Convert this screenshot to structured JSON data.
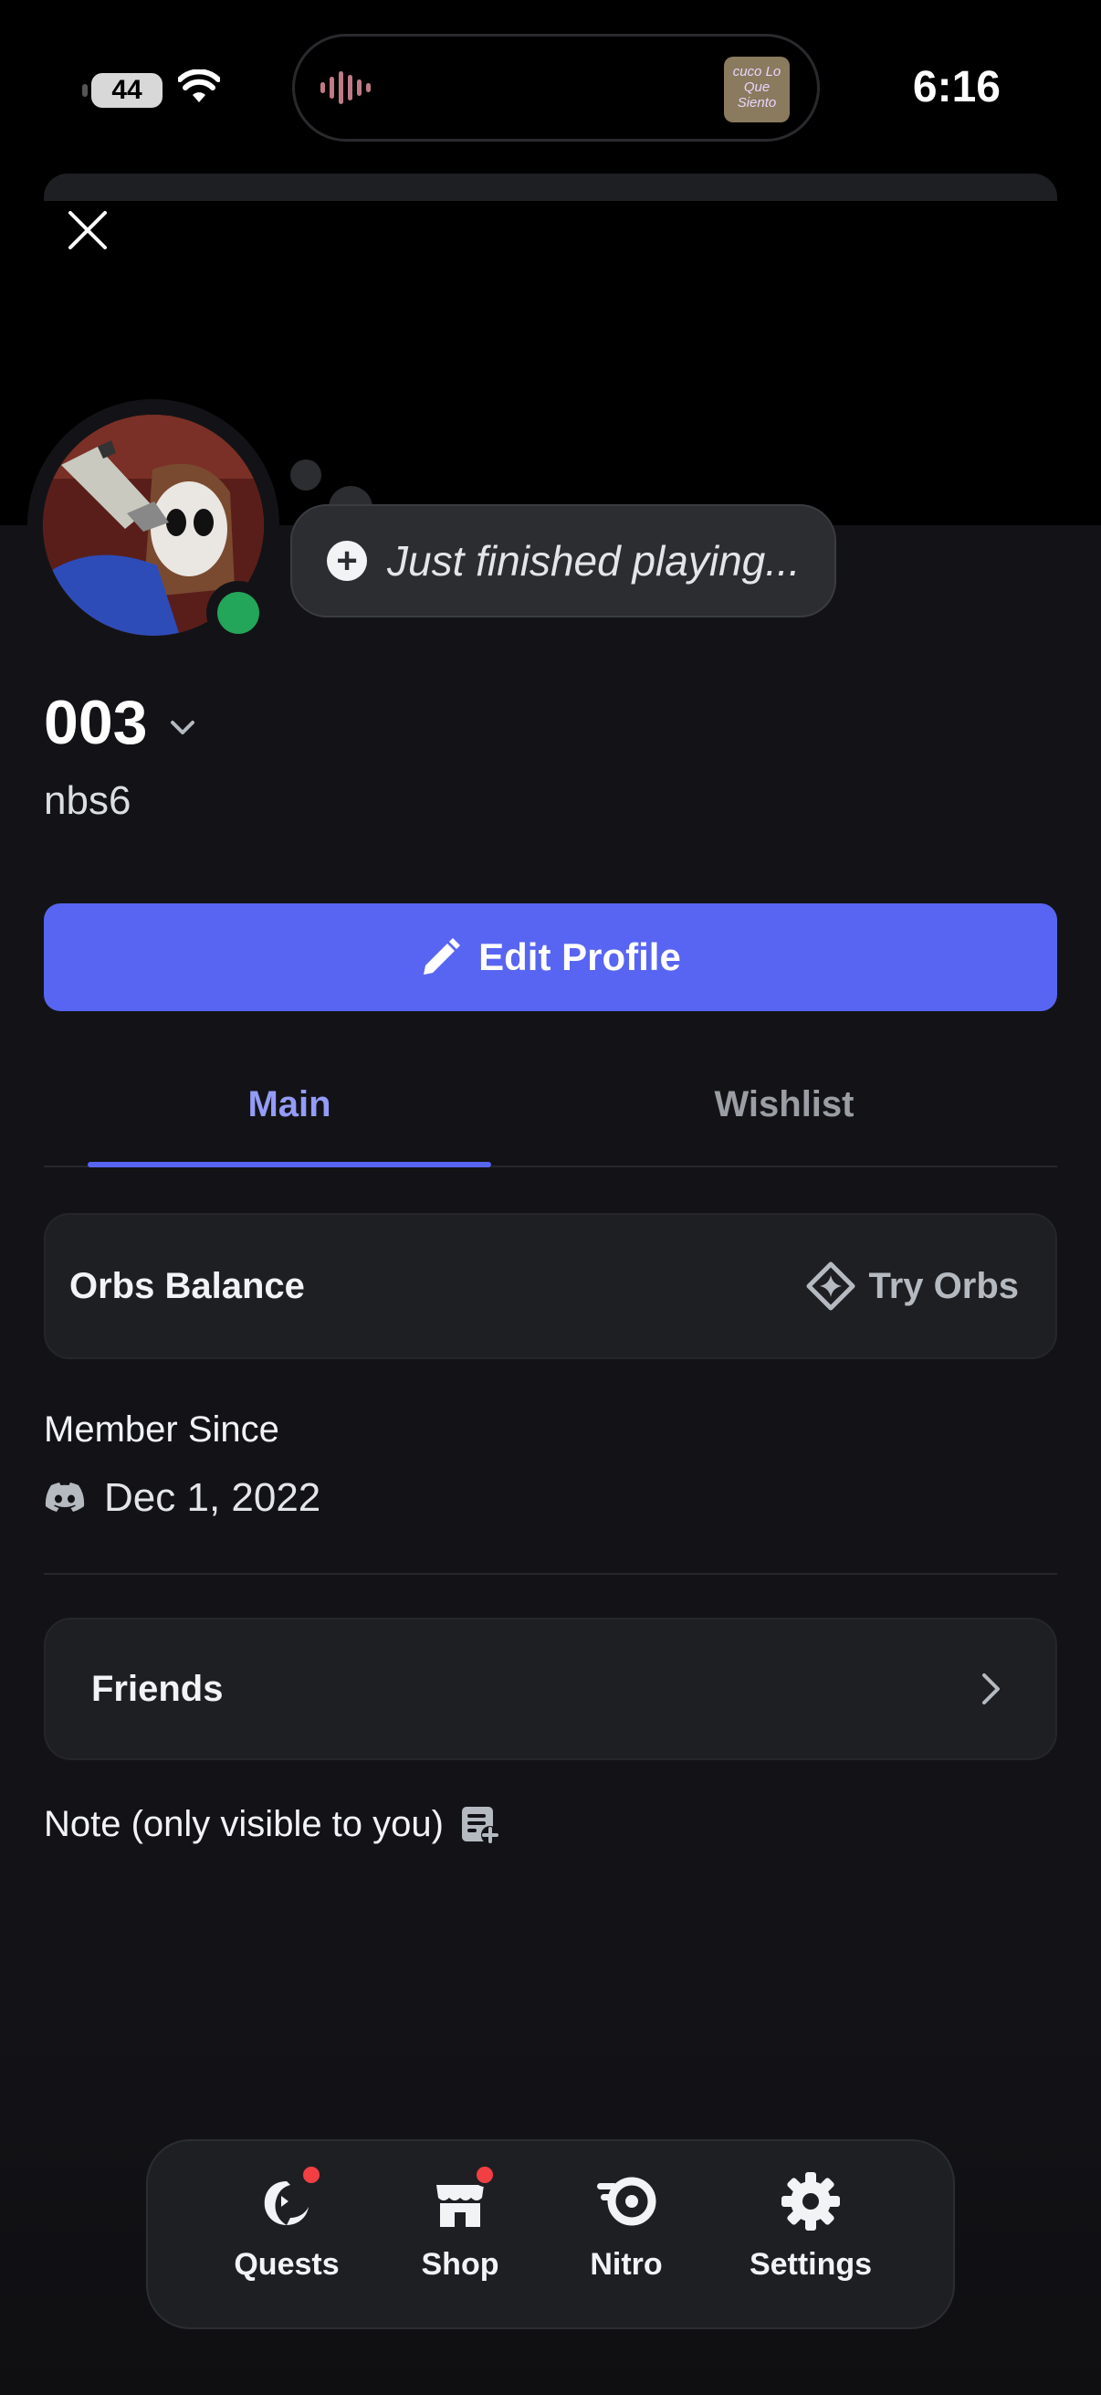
{
  "status_bar": {
    "battery": "44",
    "time": "6:16",
    "album_text": "cuco Lo Que Siento"
  },
  "profile": {
    "status_text": "Just finished playing...",
    "display_name": "003",
    "username": "nbs6",
    "online_status_color": "#23a55a"
  },
  "actions": {
    "edit_profile_label": "Edit Profile"
  },
  "tabs": [
    {
      "label": "Main",
      "active": true
    },
    {
      "label": "Wishlist",
      "active": false
    }
  ],
  "orbs": {
    "title": "Orbs Balance",
    "cta": "Try Orbs"
  },
  "member_since": {
    "label": "Member Since",
    "date": "Dec 1, 2022"
  },
  "friends": {
    "label": "Friends"
  },
  "note": {
    "label": "Note (only visible to you)"
  },
  "bottom_nav": [
    {
      "label": "Quests",
      "icon": "quests-icon",
      "badge": true
    },
    {
      "label": "Shop",
      "icon": "shop-icon",
      "badge": true
    },
    {
      "label": "Nitro",
      "icon": "nitro-icon",
      "badge": false
    },
    {
      "label": "Settings",
      "icon": "settings-icon",
      "badge": false
    }
  ],
  "colors": {
    "accent": "#5865f2",
    "tab_active": "#949cf7",
    "background": "#131317",
    "card": "#1e1f22",
    "badge": "#f23f43"
  }
}
